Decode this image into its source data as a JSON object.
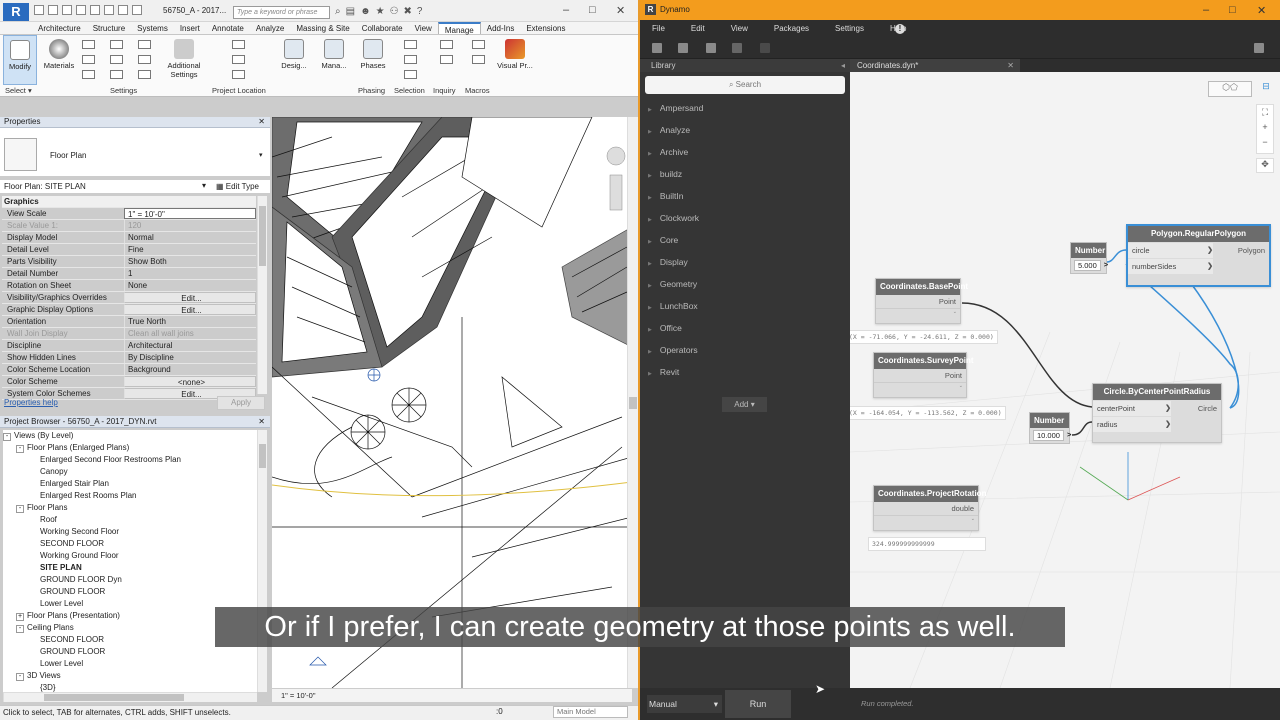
{
  "revit": {
    "doc_title": "56750_A - 2017...",
    "search_placeholder": "Type a keyword or phrase",
    "tabs": [
      "Architecture",
      "Structure",
      "Systems",
      "Insert",
      "Annotate",
      "Analyze",
      "Massing & Site",
      "Collaborate",
      "View",
      "Manage",
      "Add-Ins",
      "Extensions"
    ],
    "active_tab": "Manage",
    "ribbon": {
      "modify": "Modify",
      "select": "Select",
      "materials": "Materials",
      "additional_settings": "Additional Settings",
      "settings_panel": "Settings",
      "project_location": "Project Location",
      "design": "Desig...",
      "manage": "Mana...",
      "phases": "Phases",
      "phasing": "Phasing",
      "selection": "Selection",
      "inquiry": "Inquiry",
      "macros": "Macros",
      "visual_prog": "Visual Pr..."
    },
    "properties": {
      "title": "Properties",
      "type_name": "Floor Plan",
      "instance": "Floor Plan: SITE PLAN",
      "edit_type": "Edit Type",
      "section": "Graphics",
      "rows": [
        {
          "k": "View Scale",
          "v": "1\" = 10'-0\""
        },
        {
          "k": "Scale Value    1:",
          "v": "120"
        },
        {
          "k": "Display Model",
          "v": "Normal"
        },
        {
          "k": "Detail Level",
          "v": "Fine"
        },
        {
          "k": "Parts Visibility",
          "v": "Show Both"
        },
        {
          "k": "Detail Number",
          "v": "1"
        },
        {
          "k": "Rotation on Sheet",
          "v": "None"
        },
        {
          "k": "Visibility/Graphics Overrides",
          "v": "Edit..."
        },
        {
          "k": "Graphic Display Options",
          "v": "Edit..."
        },
        {
          "k": "Orientation",
          "v": "True North"
        },
        {
          "k": "Wall Join Display",
          "v": "Clean all wall joins"
        },
        {
          "k": "Discipline",
          "v": "Architectural"
        },
        {
          "k": "Show Hidden Lines",
          "v": "By Discipline"
        },
        {
          "k": "Color Scheme Location",
          "v": "Background"
        },
        {
          "k": "Color Scheme",
          "v": "<none>"
        },
        {
          "k": "System Color Schemes",
          "v": "Edit..."
        }
      ],
      "help": "Properties help",
      "apply": "Apply"
    },
    "browser": {
      "title": "Project Browser - 56750_A - 2017_DYN.rvt",
      "items": [
        {
          "t": "Views (By Level)",
          "lvl": 0,
          "exp": "-"
        },
        {
          "t": "Floor Plans (Enlarged Plans)",
          "lvl": 1,
          "exp": "-"
        },
        {
          "t": "Enlarged Second Floor Restrooms Plan",
          "lvl": 2
        },
        {
          "t": "Canopy",
          "lvl": 2
        },
        {
          "t": "Enlarged Stair Plan",
          "lvl": 2
        },
        {
          "t": "Enlarged Rest Rooms Plan",
          "lvl": 2
        },
        {
          "t": "Floor Plans",
          "lvl": 1,
          "exp": "-"
        },
        {
          "t": "Roof",
          "lvl": 2
        },
        {
          "t": "Working Second Floor",
          "lvl": 2
        },
        {
          "t": "SECOND FLOOR",
          "lvl": 2
        },
        {
          "t": "Working Ground Floor",
          "lvl": 2
        },
        {
          "t": "SITE PLAN",
          "lvl": 2,
          "sel": true
        },
        {
          "t": "GROUND FLOOR Dyn",
          "lvl": 2
        },
        {
          "t": "GROUND FLOOR",
          "lvl": 2
        },
        {
          "t": "Lower Level",
          "lvl": 2
        },
        {
          "t": "Floor Plans (Presentation)",
          "lvl": 1,
          "exp": "+"
        },
        {
          "t": "Ceiling Plans",
          "lvl": 1,
          "exp": "-"
        },
        {
          "t": "SECOND FLOOR",
          "lvl": 2
        },
        {
          "t": "GROUND FLOOR",
          "lvl": 2
        },
        {
          "t": "Lower Level",
          "lvl": 2
        },
        {
          "t": "3D Views",
          "lvl": 1,
          "exp": "-"
        },
        {
          "t": "{3D}",
          "lvl": 2
        }
      ]
    },
    "view_scale": "1\" = 10'-0\"",
    "status": "Click to select, TAB for alternates, CTRL adds, SHIFT unselects.",
    "status_zero": ":0",
    "main_model": "Main Model"
  },
  "dynamo": {
    "title": "Dynamo",
    "menu": [
      "File",
      "Edit",
      "View",
      "Packages",
      "Settings",
      "Help"
    ],
    "library_title": "Library",
    "search": "Search",
    "library": [
      "Ampersand",
      "Analyze",
      "Archive",
      "buildz",
      "BuiltIn",
      "Clockwork",
      "Core",
      "Display",
      "Geometry",
      "LunchBox",
      "Office",
      "Operators",
      "Revit"
    ],
    "add": "Add",
    "tab": "Coordinates.dyn*",
    "nodes": {
      "base": {
        "title": "Coordinates.BasePoint",
        "out": "Point",
        "preview": "(X = -71.066, Y = -24.611, Z = 0.000)"
      },
      "survey": {
        "title": "Coordinates.SurveyPoint",
        "out": "Point",
        "preview": "(X = -164.054, Y = -113.562, Z = 0.000)"
      },
      "rot": {
        "title": "Coordinates.ProjectRotation",
        "out": "double",
        "preview": "324.999999999999"
      },
      "poly": {
        "title": "Polygon.RegularPolygon",
        "in1": "circle",
        "in2": "numberSides",
        "out": "Polygon"
      },
      "circle": {
        "title": "Circle.ByCenterPointRadius",
        "in1": "centerPoint",
        "in2": "radius",
        "out": "Circle"
      },
      "num1": {
        "title": "Number",
        "value": "5.000"
      },
      "num2": {
        "title": "Number",
        "value": "10.000"
      }
    },
    "run_mode": "Manual",
    "run": "Run",
    "run_status": "Run completed."
  },
  "subtitle": "Or if I prefer, I can create geometry at those points as well.",
  "colors": {
    "dynamo_orange": "#f39c1d",
    "revit_blue": "#2a6bbf",
    "selection_blue": "#3a8fd6"
  }
}
